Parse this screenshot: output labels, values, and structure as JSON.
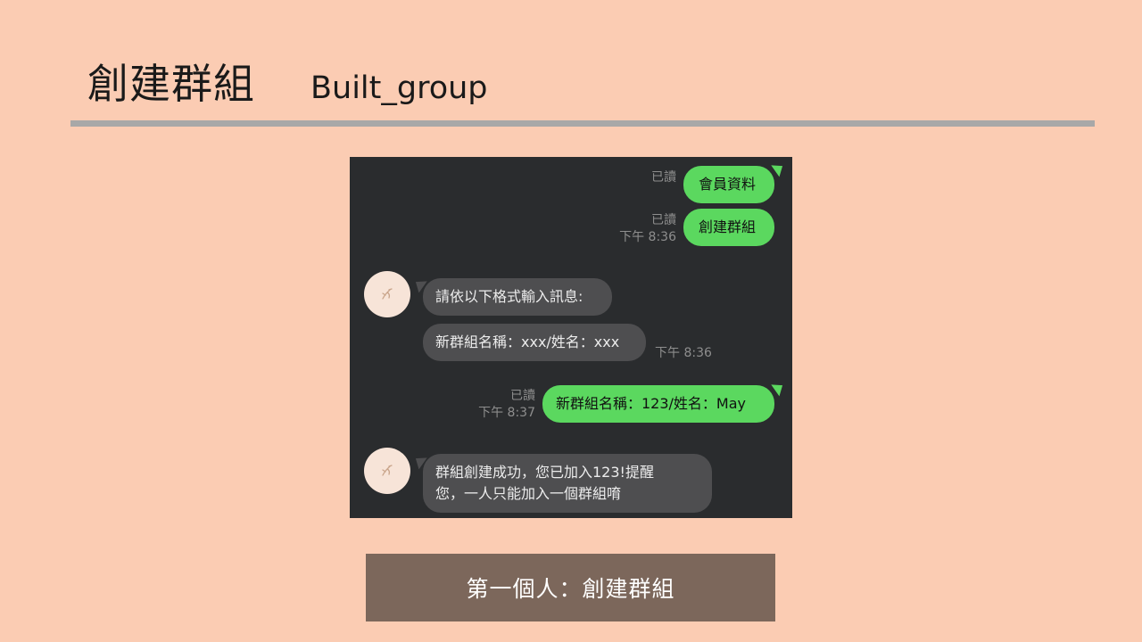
{
  "slide": {
    "title_cn": "創建群組",
    "title_en": "Built_group",
    "caption": "第一個人：創建群組"
  },
  "chat": {
    "messages": [
      {
        "side": "out",
        "text": "會員資料",
        "read": "已讀",
        "time": ""
      },
      {
        "side": "out",
        "text": "創建群組",
        "read": "已讀",
        "time": "下午 8:36"
      },
      {
        "side": "in",
        "text": "請依以下格式輸入訊息:",
        "time": ""
      },
      {
        "side": "in",
        "text": "新群組名稱：xxx/姓名：xxx",
        "time": "下午 8:36"
      },
      {
        "side": "out",
        "text": "新群組名稱：123/姓名：May",
        "read": "已讀",
        "time": "下午 8:37"
      },
      {
        "side": "in",
        "text_line1": "群組創建成功，您已加入123!提醒",
        "text_line2": "您，一人只能加入一個群組唷",
        "time": ""
      }
    ]
  },
  "colors": {
    "background": "#FBCCB3",
    "chat_background": "#2A2C2E",
    "outgoing_bubble": "#5BD85F",
    "incoming_bubble": "#4E4E50",
    "caption_box": "#7C675B",
    "rule": "#A8A8A8"
  },
  "icons": {
    "avatar": "bot-avatar-icon"
  }
}
